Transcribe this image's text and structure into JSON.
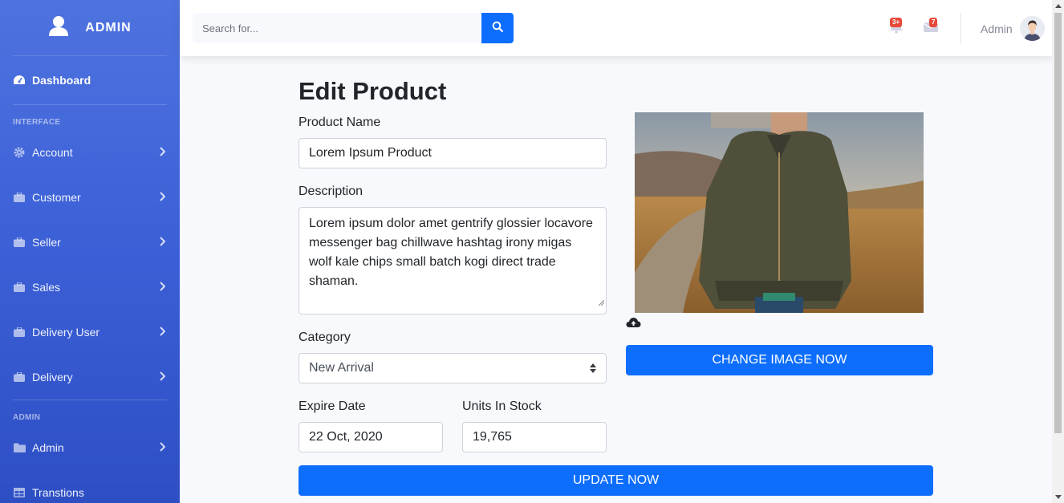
{
  "sidebar": {
    "brand": "ADMIN",
    "dashboard": "Dashboard",
    "heading_interface": "INTERFACE",
    "items": [
      {
        "label": "Account",
        "icon": "gear-icon"
      },
      {
        "label": "Customer",
        "icon": "briefcase-icon"
      },
      {
        "label": "Seller",
        "icon": "briefcase-icon"
      },
      {
        "label": "Sales",
        "icon": "briefcase-icon"
      },
      {
        "label": "Delivery User",
        "icon": "briefcase-icon"
      },
      {
        "label": "Delivery",
        "icon": "briefcase-icon"
      }
    ],
    "heading_admin": "ADMIN",
    "admin_items": [
      {
        "label": "Admin",
        "icon": "folder-icon"
      },
      {
        "label": "Transtions",
        "icon": "table-icon"
      }
    ]
  },
  "topbar": {
    "search_placeholder": "Search for...",
    "alerts_badge": "3+",
    "messages_badge": "7",
    "user_name": "Admin"
  },
  "form": {
    "title": "Edit Product",
    "product_name_label": "Product Name",
    "product_name_value": "Lorem Ipsum Product",
    "description_label": "Description",
    "description_value": "Lorem ipsum dolor amet gentrify glossier locavore messenger bag chillwave hashtag irony migas wolf kale chips small batch kogi direct trade shaman.",
    "category_label": "Category",
    "category_value": "New Arrival",
    "expire_label": "Expire Date",
    "expire_value": "22 Oct, 2020",
    "stock_label": "Units In Stock",
    "stock_value": "19,765",
    "change_image_button": "CHANGE IMAGE NOW",
    "update_button": "UPDATE NOW"
  },
  "colors": {
    "sidebar": "#4e73df",
    "primary": "#0d6efd",
    "badge": "#e74a3b",
    "background": "#f8f9fc"
  }
}
